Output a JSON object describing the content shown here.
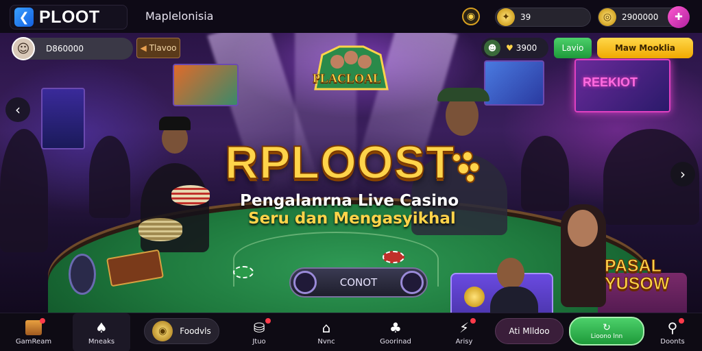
{
  "topbar": {
    "logo_text": "PLOOT",
    "site_name": "Maplelonisia",
    "balance": "39",
    "coins": "2900000",
    "coin_icon": "coin-icon",
    "menu_icon": "menu-icon"
  },
  "userbar": {
    "user_id": "D860000",
    "tag_label": "Tlavoo",
    "stat_value": "3900",
    "green_label": "Lavio",
    "yellow_label": "Maw Mooklia"
  },
  "hero": {
    "game_logo": "PLACLOAL",
    "title": "RPLOOST",
    "subtitle_1": "Pengalanrna Live Casino",
    "subtitle_2": "Seru dan Mengasyikhal",
    "cta_label": "CONOT",
    "neon_sign": "REEKIOT"
  },
  "promo": {
    "text_1": "PASAL",
    "text_2": "YUSOW"
  },
  "bottombar": {
    "items": [
      {
        "label": "GamReam",
        "icon": "shop-icon"
      },
      {
        "label": "Mneaks",
        "icon": "spade-icon"
      },
      {
        "label": "Foodvls",
        "icon": "coin-icon"
      },
      {
        "label": "Jtuo",
        "icon": "chip-icon"
      },
      {
        "label": "Nvnc",
        "icon": "house-icon"
      },
      {
        "label": "Goorinad",
        "icon": "clover-icon"
      },
      {
        "label": "Arisy",
        "icon": "lightning-icon"
      },
      {
        "label": "Ati Mlldoo"
      },
      {
        "label": "Lioono lnn"
      },
      {
        "label": "Doonts",
        "icon": "pin-icon"
      }
    ]
  },
  "colors": {
    "accent_gold": "#ffd44a",
    "accent_green": "#2ab44a",
    "accent_magenta": "#d040c0"
  }
}
